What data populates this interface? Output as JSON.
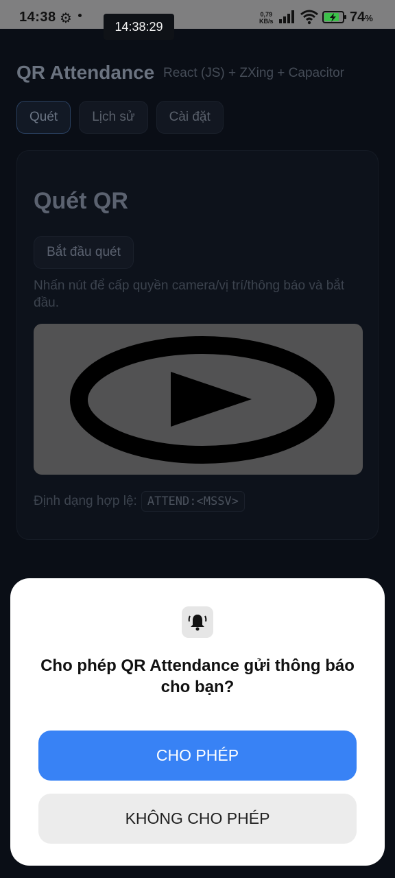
{
  "status_bar": {
    "time": "14:38",
    "clock_overlay": "14:38:29",
    "net_speed_value": "0,79",
    "net_speed_unit": "KB/s",
    "battery_percent": "74",
    "battery_suffix": "%",
    "icons": [
      "gear-icon",
      "signal-icon",
      "wifi-icon",
      "battery-charging-icon"
    ]
  },
  "app": {
    "title": "QR Attendance",
    "subtitle": "React (JS) + ZXing + Capacitor",
    "tabs": [
      {
        "label": "Quét",
        "active": true
      },
      {
        "label": "Lịch sử",
        "active": false
      },
      {
        "label": "Cài đặt",
        "active": false
      }
    ],
    "card": {
      "title": "Quét QR",
      "start_button": "Bắt đầu quét",
      "hint": "Nhấn nút để cấp quyền camera/vị trí/thông báo và bắt đầu.",
      "format_label": "Định dạng hợp lệ:",
      "format_code": "ATTEND:<MSSV>"
    }
  },
  "dialog": {
    "icon": "bell-ringing-icon",
    "title": "Cho phép QR Attendance gửi thông báo cho bạn?",
    "allow_button": "CHO PHÉP",
    "deny_button": "KHÔNG CHO PHÉP",
    "accent_color": "#3882f5"
  }
}
